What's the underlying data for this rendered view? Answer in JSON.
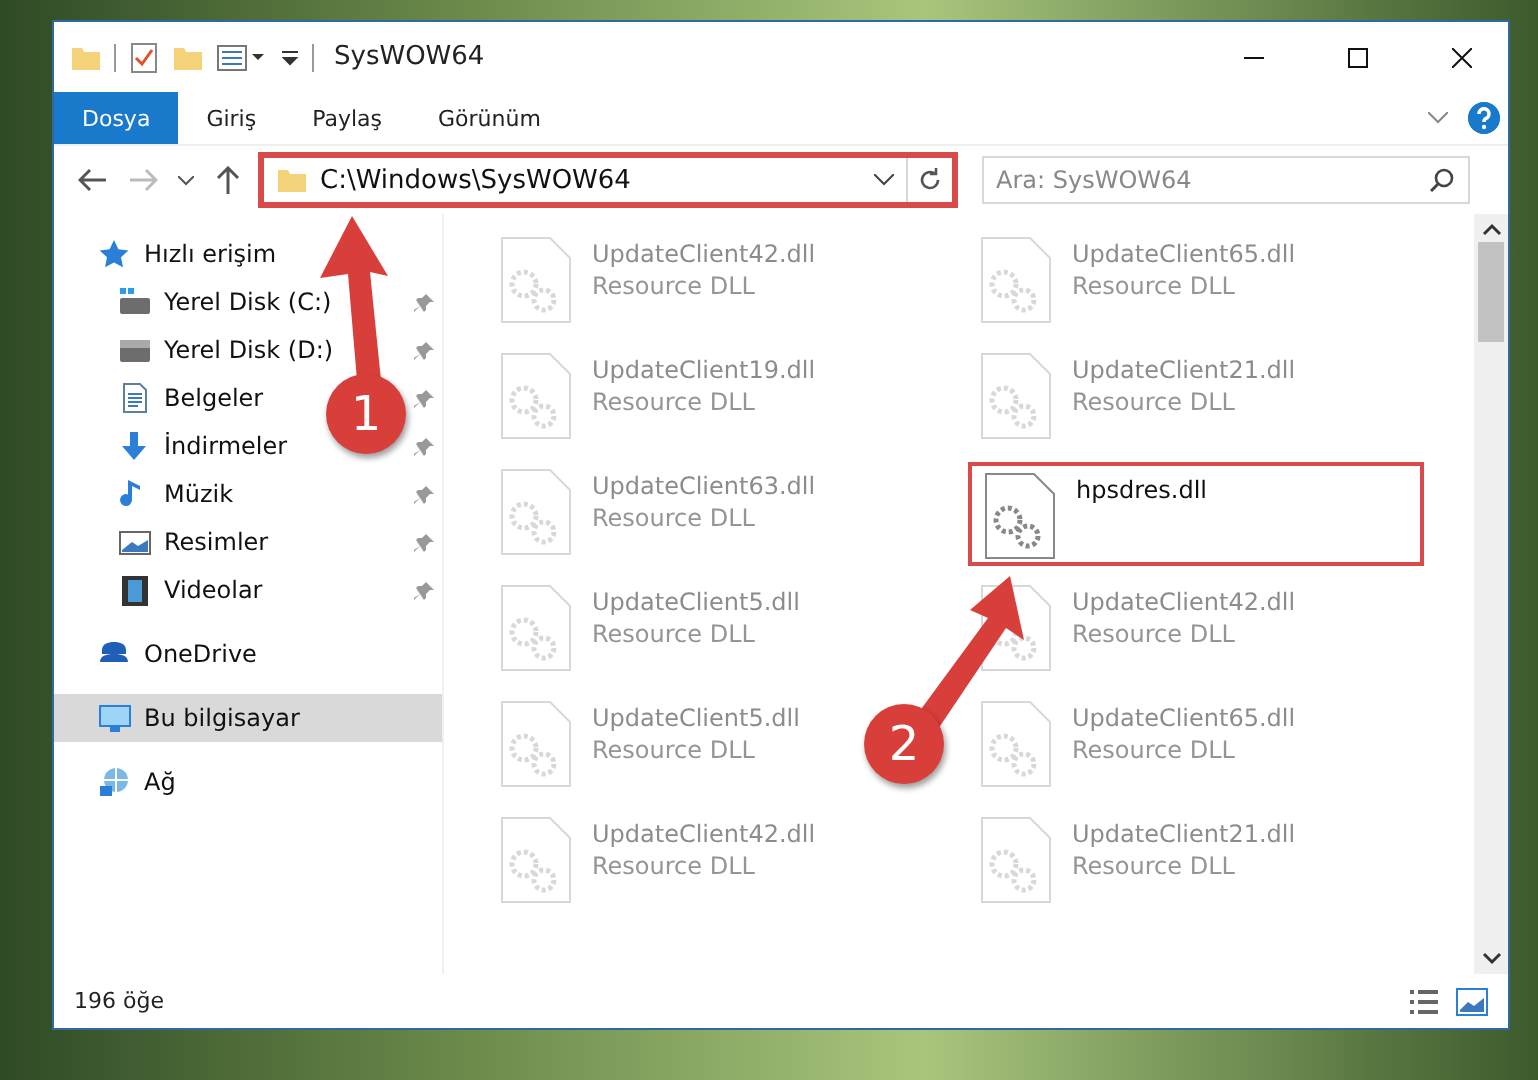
{
  "window": {
    "title": "SysWOW64"
  },
  "ribbon_tabs": [
    {
      "label": "Dosya",
      "selected": true
    },
    {
      "label": "Giriş",
      "selected": false
    },
    {
      "label": "Paylaş",
      "selected": false
    },
    {
      "label": "Görünüm",
      "selected": false
    }
  ],
  "address": {
    "value": "C:\\Windows\\SysWOW64",
    "highlighted": true
  },
  "search": {
    "placeholder": "Ara: SysWOW64"
  },
  "sidebar": {
    "items": [
      {
        "label": "Hızlı erişim",
        "selected": false,
        "children": [
          {
            "label": "Yerel Disk (C:)",
            "pinned": true
          },
          {
            "label": "Yerel Disk (D:)",
            "pinned": true
          },
          {
            "label": "Belgeler",
            "pinned": true
          },
          {
            "label": "İndirmeler",
            "pinned": true
          },
          {
            "label": "Müzik",
            "pinned": true
          },
          {
            "label": "Resimler",
            "pinned": true
          },
          {
            "label": "Videolar",
            "pinned": true
          }
        ]
      },
      {
        "label": "OneDrive",
        "selected": false
      },
      {
        "label": "Bu bilgisayar",
        "selected": true
      },
      {
        "label": "Ağ",
        "selected": false
      }
    ]
  },
  "files": [
    {
      "name": "UpdateClient42.dll",
      "type": "Resource DLL",
      "highlighted": false
    },
    {
      "name": "UpdateClient65.dll",
      "type": "Resource DLL",
      "highlighted": false
    },
    {
      "name": "UpdateClient19.dll",
      "type": "Resource DLL",
      "highlighted": false
    },
    {
      "name": "UpdateClient21.dll",
      "type": "Resource DLL",
      "highlighted": false
    },
    {
      "name": "UpdateClient63.dll",
      "type": "Resource DLL",
      "highlighted": false
    },
    {
      "name": "hpsdres.dll",
      "highlighted": true
    },
    {
      "name": "UpdateClient5.dll",
      "type": "Resource DLL",
      "highlighted": false
    },
    {
      "name": "UpdateClient42.dll",
      "type": "Resource DLL",
      "highlighted": false
    },
    {
      "name": "UpdateClient5.dll",
      "type": "Resource DLL",
      "highlighted": false
    },
    {
      "name": "UpdateClient65.dll",
      "type": "Resource DLL",
      "highlighted": false
    },
    {
      "name": "UpdateClient42.dll",
      "type": "Resource DLL",
      "highlighted": false
    },
    {
      "name": "UpdateClient21.dll",
      "type": "Resource DLL",
      "highlighted": false
    }
  ],
  "status_bar": {
    "count": "196 öğe"
  },
  "annotations": [
    {
      "number": "1"
    },
    {
      "number": "2"
    }
  ]
}
